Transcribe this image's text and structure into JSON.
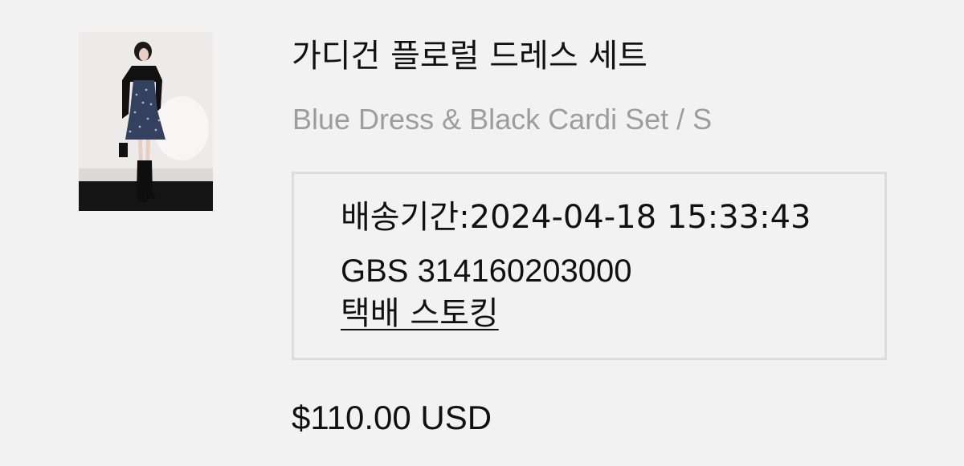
{
  "product": {
    "title": "가디건 플로럴 드레스 세트",
    "variant": "Blue Dress & Black Cardi Set / S",
    "image_alt": "model wearing blue floral dress with black cardigan"
  },
  "shipping": {
    "date_line": "배송기간:2024-04-18 15:33:43",
    "tracking_line": "GBS 314160203000",
    "carrier_link": "택배 스토킹"
  },
  "price": {
    "amount": "$110.00 USD"
  },
  "colors": {
    "background": "#f2f2f2",
    "text": "#111111",
    "muted_text": "#9d9d9d",
    "box_border": "#dcdcdc"
  }
}
